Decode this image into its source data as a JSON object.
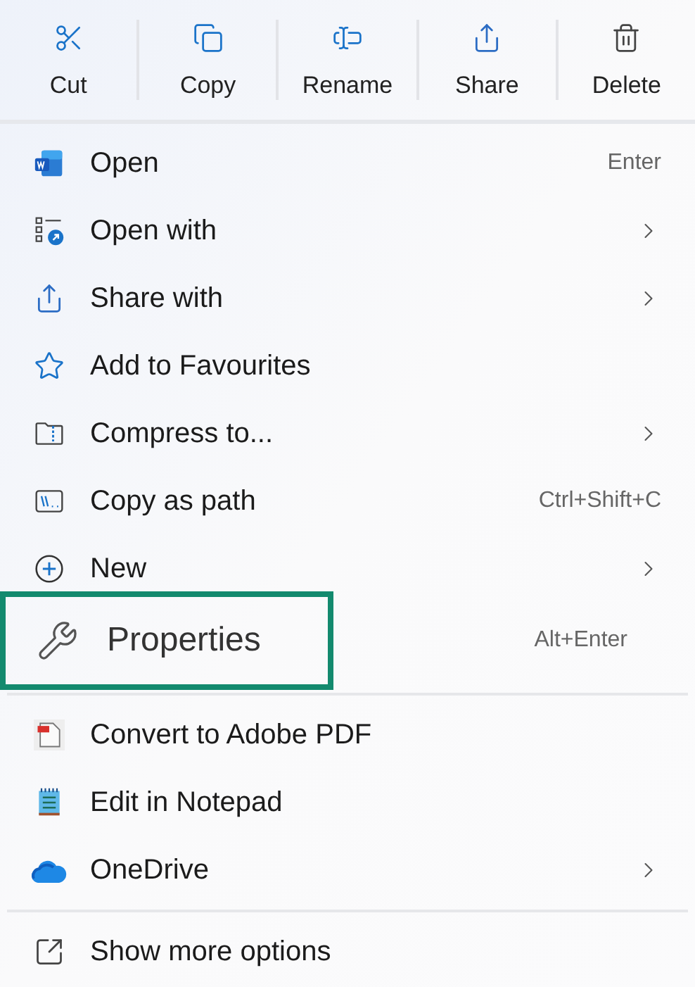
{
  "toolbar": [
    {
      "label": "Cut",
      "kind": "scissors"
    },
    {
      "label": "Copy",
      "kind": "copy"
    },
    {
      "label": "Rename",
      "kind": "rename"
    },
    {
      "label": "Share",
      "kind": "share"
    },
    {
      "label": "Delete",
      "kind": "trash"
    }
  ],
  "sections": [
    {
      "items": [
        {
          "label": "Open",
          "kind": "word",
          "shortcut": "Enter",
          "submenu": false,
          "highlighted": false
        },
        {
          "label": "Open with",
          "kind": "open-with",
          "submenu": true,
          "highlighted": false
        },
        {
          "label": "Share with",
          "kind": "share",
          "submenu": true,
          "highlighted": false
        },
        {
          "label": "Add to Favourites",
          "kind": "star",
          "submenu": false,
          "highlighted": false
        },
        {
          "label": "Compress to...",
          "kind": "zip",
          "submenu": true,
          "highlighted": false
        },
        {
          "label": "Copy as path",
          "kind": "path",
          "shortcut": "Ctrl+Shift+C",
          "submenu": false,
          "highlighted": false
        },
        {
          "label": "New",
          "kind": "plus",
          "submenu": true,
          "highlighted": false
        },
        {
          "label": "Properties",
          "kind": "wrench",
          "shortcut": "Alt+Enter",
          "submenu": false,
          "highlighted": true
        }
      ]
    },
    {
      "items": [
        {
          "label": "Convert to Adobe PDF",
          "kind": "pdf",
          "submenu": false,
          "highlighted": false
        },
        {
          "label": "Edit in Notepad",
          "kind": "notepad",
          "submenu": false,
          "highlighted": false
        },
        {
          "label": "OneDrive",
          "kind": "cloud",
          "submenu": true,
          "highlighted": false
        }
      ]
    },
    {
      "items": [
        {
          "label": "Show more options",
          "kind": "more",
          "submenu": false,
          "highlighted": false
        }
      ]
    }
  ]
}
